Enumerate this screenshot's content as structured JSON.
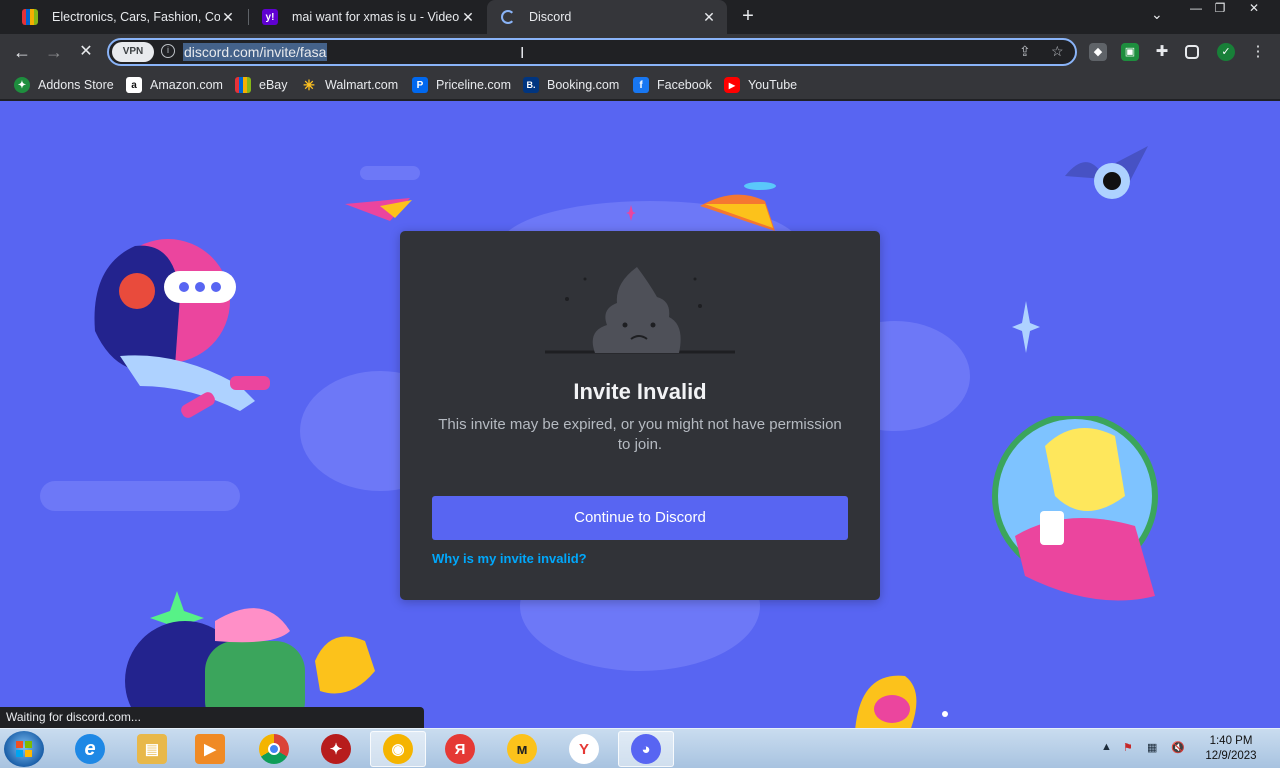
{
  "browser": {
    "tabs": [
      {
        "title": "Electronics, Cars, Fashion, Collect",
        "favicon": "ebay-icon"
      },
      {
        "title": "mai want for xmas is u - Video Se",
        "favicon": "yahoo-icon",
        "favicon_text": "y!"
      },
      {
        "title": "Discord",
        "favicon": "loading-spinner-icon"
      }
    ],
    "url": "discord.com/invite/fasa",
    "vpn_label": "VPN",
    "bookmarks": [
      {
        "label": "Addons Store",
        "icon": "addons-store-icon"
      },
      {
        "label": "Amazon.com",
        "icon": "amazon-icon",
        "glyph": "a"
      },
      {
        "label": "eBay",
        "icon": "ebay-icon"
      },
      {
        "label": "Walmart.com",
        "icon": "walmart-icon",
        "glyph": "✳"
      },
      {
        "label": "Priceline.com",
        "icon": "priceline-icon",
        "glyph": "P"
      },
      {
        "label": "Booking.com",
        "icon": "booking-icon",
        "glyph": "B."
      },
      {
        "label": "Facebook",
        "icon": "facebook-icon",
        "glyph": "f"
      },
      {
        "label": "YouTube",
        "icon": "youtube-icon",
        "glyph": "▶"
      }
    ],
    "status_text": "Waiting for discord.com..."
  },
  "invite": {
    "title": "Invite Invalid",
    "description": "This invite may be expired, or you might not have permission to join.",
    "continue_label": "Continue to Discord",
    "why_link": "Why is my invite invalid?"
  },
  "taskbar": {
    "apps": [
      {
        "name": "internet-explorer",
        "glyph": "e",
        "color": "#1e88e5"
      },
      {
        "name": "file-explorer",
        "glyph": "▤",
        "color": "#e8b84a"
      },
      {
        "name": "media-player",
        "glyph": "▶",
        "color": "#f08a24"
      },
      {
        "name": "chrome",
        "glyph": "",
        "color": "#db4437"
      },
      {
        "name": "antivirus",
        "glyph": "✦",
        "color": "#c62828"
      },
      {
        "name": "browser-active",
        "glyph": "◉",
        "color": "#f5b400"
      },
      {
        "name": "yandex",
        "glyph": "Я",
        "color": "#e53935"
      },
      {
        "name": "yandex-market",
        "glyph": "м",
        "color": "#222222"
      },
      {
        "name": "yandex-browser",
        "glyph": "Y",
        "color": "#e53935"
      },
      {
        "name": "discord",
        "glyph": "◕",
        "color": "#5865f2"
      }
    ],
    "time": "1:40 PM",
    "date": "12/9/2023"
  },
  "colors": {
    "discord_blurple": "#5865f2",
    "card_bg": "#313338",
    "link": "#00a8fc"
  }
}
